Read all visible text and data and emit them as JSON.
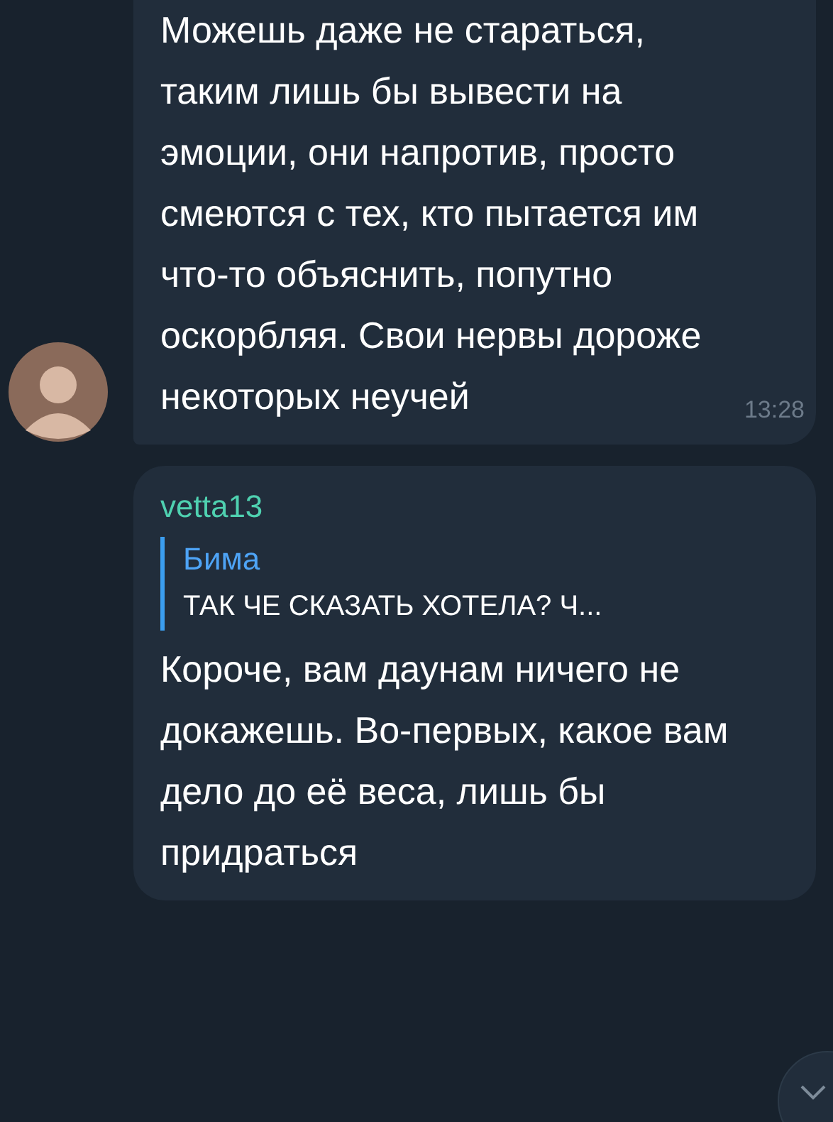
{
  "messages": [
    {
      "kind": "text",
      "text": "Можешь даже не стараться, таким лишь бы вывести на эмоции, они напротив, просто смеются с тех, кто пытается им что-то объяснить, попутно оскорбляя. Свои нервы дороже некоторых неучей",
      "time": "13:28",
      "avatar": true
    },
    {
      "kind": "reply",
      "sender": "vetta13",
      "reply": {
        "author": "Бима",
        "text": "ТАК ЧЕ СКАЗАТЬ ХОТЕЛА? Ч..."
      },
      "text": "Короче, вам даунам ничего не докажешь. Во-первых, какое вам дело до её веса, лишь бы придраться"
    }
  ]
}
